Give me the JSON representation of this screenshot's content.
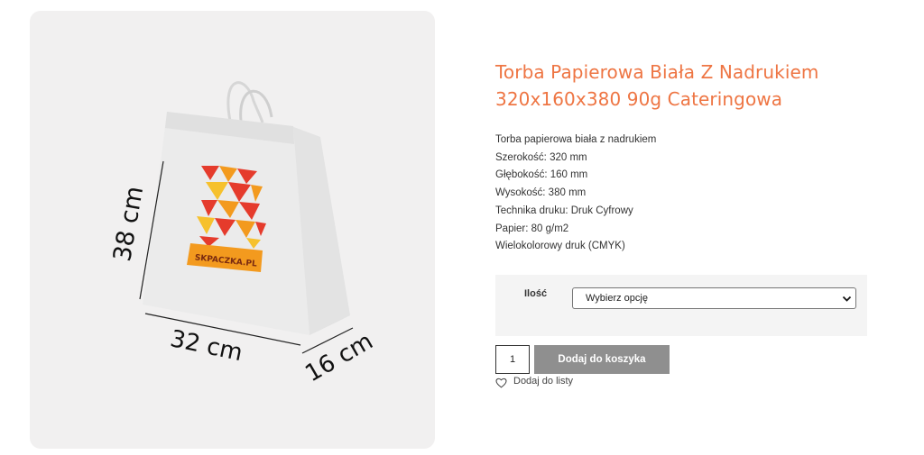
{
  "product": {
    "title": "Torba Papierowa Biała Z Nadrukiem 320x160x380 90g Cateringowa",
    "description_lines": [
      "Torba papierowa biała z nadrukiem",
      "Szerokość: 320 mm",
      "Głębokość: 160 mm",
      "Wysokość: 380 mm",
      "Technika druku: Druk Cyfrowy",
      "Papier: 80 g/m2",
      "Wielokolorowy druk (CMYK)"
    ],
    "image": {
      "dimension_height": "38 cm",
      "dimension_width": "32 cm",
      "dimension_depth": "16 cm",
      "logo_text": "SKPACZKA.PL"
    }
  },
  "variation": {
    "label": "Ilość",
    "selected": "Wybierz opcję"
  },
  "cart": {
    "quantity": "1",
    "add_label": "Dodaj do koszyka"
  },
  "wishlist": {
    "label": "Dodaj do listy"
  },
  "colors": {
    "title": "#ee7543",
    "button": "#8f8f8f",
    "panel": "#f1f0f0",
    "logo_red": "#e53b2c",
    "logo_orange": "#f39a1e",
    "logo_yellow": "#f6c12d"
  }
}
